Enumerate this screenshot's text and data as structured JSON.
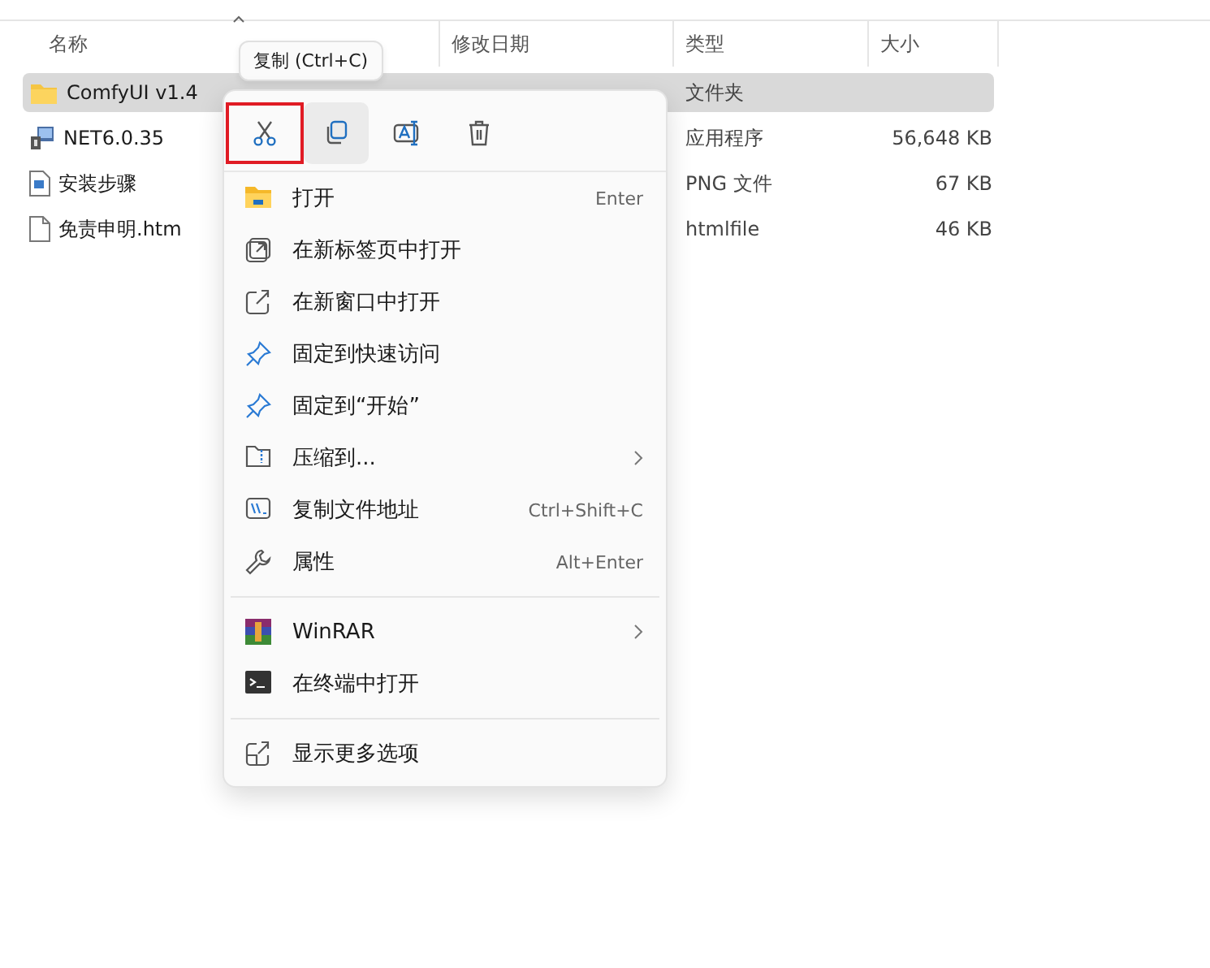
{
  "columns": [
    "名称",
    "修改日期",
    "类型",
    "大小"
  ],
  "files": [
    {
      "name": "ComfyUI v1.4",
      "kind": "folder",
      "type": "文件夹",
      "selected": true
    },
    {
      "name": "NET6.0.35",
      "kind": "installer",
      "type": "应用程序",
      "size": "56,648 KB",
      "selected": false
    },
    {
      "name": "安装步骤",
      "kind": "image",
      "type": "PNG 文件",
      "size": "67 KB",
      "selected": false
    },
    {
      "name": "免责申明.htm",
      "kind": "doc",
      "type": "htmlfile",
      "size": "46 KB",
      "selected": false
    }
  ],
  "tooltip": "复制 (Ctrl+C)",
  "toolbar": [
    {
      "kind": "cut",
      "highlighted": true,
      "hovered": false
    },
    {
      "kind": "copy",
      "highlighted": false,
      "hovered": true
    },
    {
      "kind": "rename",
      "highlighted": false,
      "hovered": false
    },
    {
      "kind": "delete",
      "highlighted": false,
      "hovered": false
    }
  ],
  "menu_groups": [
    [
      {
        "kind": "open",
        "label": "打开",
        "shortcut": "Enter",
        "submenu": false
      },
      {
        "kind": "newtab",
        "label": "在新标签页中打开",
        "submenu": false
      },
      {
        "kind": "newwindow",
        "label": "在新窗口中打开",
        "submenu": false
      },
      {
        "kind": "pin",
        "label": "固定到快速访问",
        "submenu": false
      },
      {
        "kind": "pin",
        "label": "固定到“开始”",
        "submenu": false
      },
      {
        "kind": "zip",
        "label": "压缩到...",
        "submenu": true
      },
      {
        "kind": "path",
        "label": "复制文件地址",
        "shortcut": "Ctrl+Shift+C",
        "submenu": false
      },
      {
        "kind": "props",
        "label": "属性",
        "shortcut": "Alt+Enter",
        "submenu": false
      }
    ],
    [
      {
        "kind": "winrar",
        "label": "WinRAR",
        "submenu": true
      },
      {
        "kind": "terminal",
        "label": "在终端中打开",
        "submenu": false
      }
    ],
    [
      {
        "kind": "more",
        "label": "显示更多选项",
        "submenu": false
      }
    ]
  ]
}
